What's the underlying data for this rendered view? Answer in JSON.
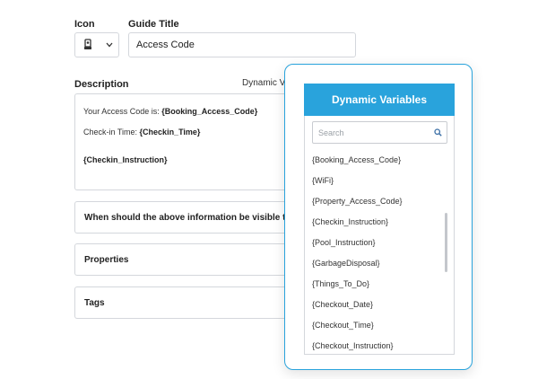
{
  "form": {
    "icon_label": "Icon",
    "guide_title_label": "Guide Title",
    "guide_title_value": "Access Code",
    "description_label": "Description",
    "dynamic_vars_link": "Dynamic Variables",
    "description": {
      "line1_prefix": "Your Access Code is:",
      "line1_var": "{Booking_Access_Code}",
      "line2_prefix": "Check-in Time:",
      "line2_var": "{Checkin_Time}",
      "line3_var": "{Checkin_Instruction}"
    },
    "sections": {
      "visible": "When should the above information be visible to guest",
      "properties": "Properties",
      "tags": "Tags"
    }
  },
  "popup": {
    "title": "Dynamic Variables",
    "search_placeholder": "Search",
    "items": [
      "{Booking_Access_Code}",
      "{WiFi}",
      "{Property_Access_Code}",
      "{Checkin_Instruction}",
      "{Pool_Instruction}",
      "{GarbageDisposal}",
      "{Things_To_Do}",
      "{Checkout_Date}",
      "{Checkout_Time}",
      "{Checkout_Instruction}"
    ]
  },
  "colors": {
    "accent": "#29a3dc",
    "border": "#d4d7dc"
  },
  "icons": {
    "icon_select": "key-lock-icon",
    "dropdown": "chevron-down-icon",
    "search": "search-icon"
  }
}
